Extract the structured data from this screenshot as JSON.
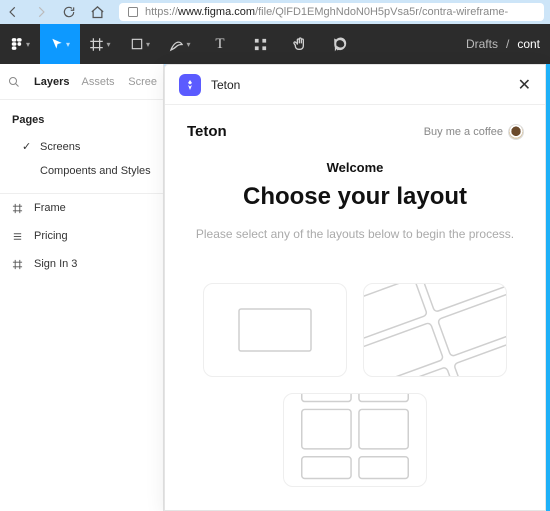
{
  "browser": {
    "url_prefix": "https://",
    "url_host": "www.figma.com",
    "url_path": "/file/QlFD1EMghNdoN0H5pVsa5r/contra-wireframe-"
  },
  "toolbar": {
    "breadcrumb_root": "Drafts",
    "breadcrumb_sep": "/",
    "breadcrumb_current": "cont"
  },
  "leftPanel": {
    "tabs": {
      "layers": "Layers",
      "assets": "Assets",
      "right": "Scree"
    },
    "pagesLabel": "Pages",
    "pages": [
      {
        "label": "Screens",
        "checked": true
      },
      {
        "label": "Compoents and Styles",
        "checked": false
      }
    ],
    "layers": [
      {
        "icon": "frame",
        "label": "Frame"
      },
      {
        "icon": "list",
        "label": "Pricing"
      },
      {
        "icon": "frame",
        "label": "Sign In 3"
      }
    ]
  },
  "plugin": {
    "name": "Teton",
    "brand": "Teton",
    "coffee": "Buy me a coffee",
    "welcome": "Welcome",
    "headline": "Choose your layout",
    "sub": "Please select any of the layouts below to begin the process."
  }
}
